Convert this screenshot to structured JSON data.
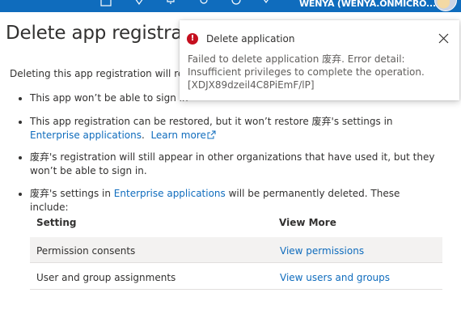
{
  "topbar": {
    "account": "WENYA (WENYA.ONMICRO...",
    "icons": [
      "feedback-icon",
      "support-icon",
      "notifications-icon",
      "settings-icon",
      "help-icon",
      "people-icon"
    ]
  },
  "page": {
    "title": "Delete app registrat",
    "intro": "Deleting this app registration will res"
  },
  "bullets": {
    "b1": "This app won’t be able to sign in",
    "b2_pre": "This app registration can be restored, but it won’t restore 废弃's settings in ",
    "b2_link": "Enterprise applications",
    "b2_mid": ".  ",
    "b2_learn": "Learn more",
    "b3": "废弃's registration will still appear in other organizations that have used it, but they won’t be able to sign in.",
    "b4_pre": "废弃's settings in ",
    "b4_link": "Enterprise applications",
    "b4_post": " will be permanently deleted. These include:"
  },
  "table": {
    "headers": [
      "Setting",
      "View More"
    ],
    "rows": [
      {
        "setting": "Permission consents",
        "action": "View permissions"
      },
      {
        "setting": "User and group assignments",
        "action": "View users and groups"
      }
    ]
  },
  "toast": {
    "title": "Delete application",
    "message": "Failed to delete application 废弃. Error detail: Insufficient privileges to complete the operation. [XDJX89dzeil4C8PiEmF/lP]",
    "status_color": "#c50f1f"
  },
  "colors": {
    "accent": "#0f6cbd",
    "error": "#c50f1f"
  }
}
